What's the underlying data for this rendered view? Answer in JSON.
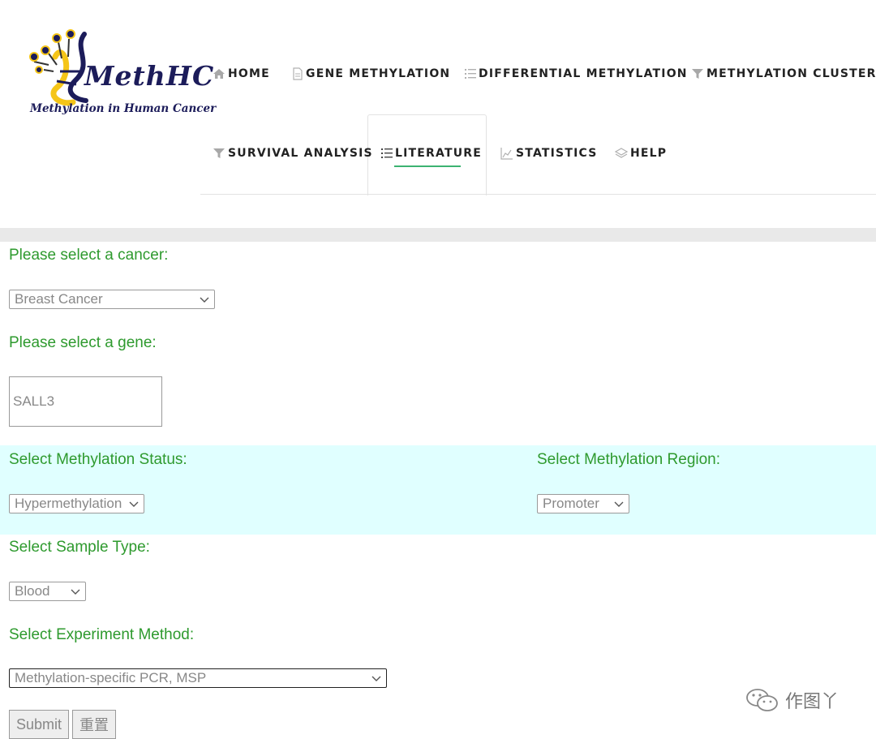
{
  "logo": {
    "title": "MethHC",
    "tagline": "Methylation in Human Cancer"
  },
  "nav": {
    "home": "HOME",
    "gene_methylation": "GENE METHYLATION",
    "differential_methylation": "DIFFERENTIAL METHYLATION",
    "methylation_cluster": "METHYLATION CLUSTER",
    "survival_analysis": "SURVIVAL ANALYSIS",
    "literature": "LITERATURE",
    "statistics": "STATISTICS",
    "help": "HELP",
    "active": "LITERATURE"
  },
  "form": {
    "cancer_label": "Please select a cancer:",
    "cancer_value": "Breast Cancer",
    "gene_label": "Please select a gene:",
    "gene_value": "SALL3",
    "status_label": "Select Methylation Status:",
    "status_value": "Hypermethylation",
    "region_label": "Select Methylation Region:",
    "region_value": "Promoter",
    "sample_label": "Select Sample Type:",
    "sample_value": "Blood",
    "method_label": "Select Experiment Method:",
    "method_value": "Methylation-specific PCR, MSP",
    "submit": "Submit",
    "reset": "重置"
  },
  "watermark": {
    "text": "作图丫"
  },
  "colors": {
    "label_green": "#2e9a2e",
    "band_cyan": "#e0ffff",
    "active_underline": "#3cb371",
    "logo_yellow": "#f5c518",
    "logo_navy": "#1c1c5a"
  },
  "icons": {
    "home": "home-icon",
    "gene": "document-icon",
    "differential": "list-icon",
    "cluster": "filter-icon",
    "survival": "filter-icon",
    "literature": "list-icon",
    "statistics": "area-chart-icon",
    "help": "layers-icon"
  }
}
